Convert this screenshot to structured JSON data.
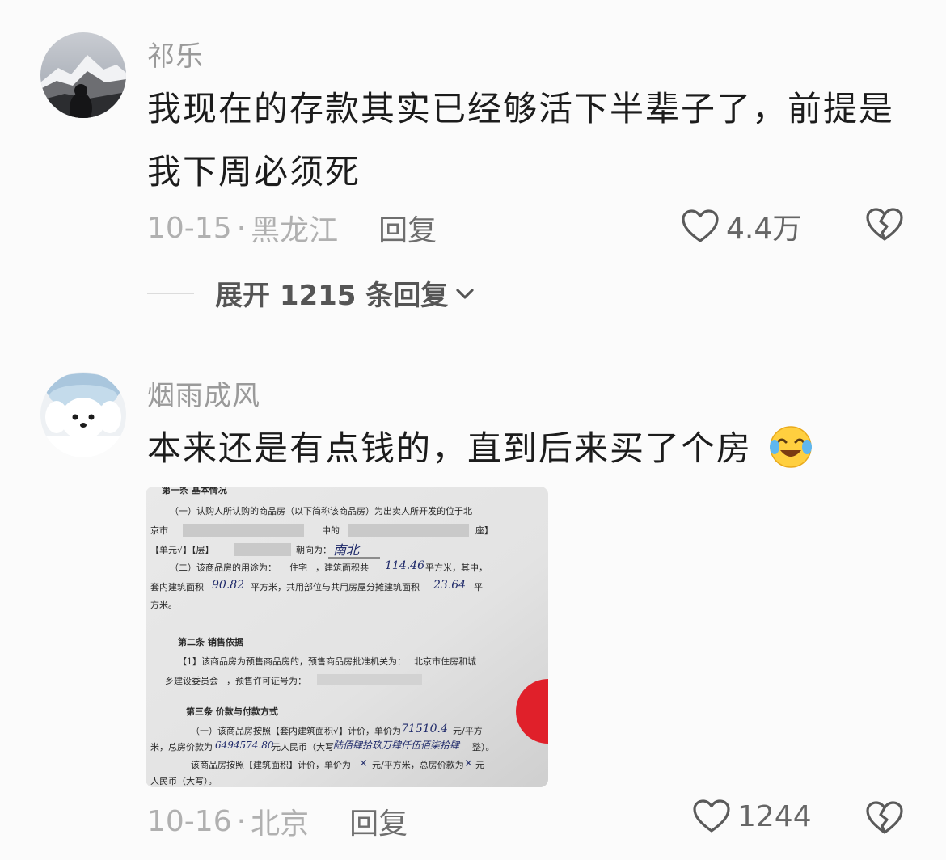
{
  "comments": [
    {
      "username": "祁乐",
      "content": "我现在的存款其实已经够活下半辈子了，前提是我下周必须死",
      "date": "10-15",
      "location": "黑龙江",
      "reply_label": "回复",
      "like_count": "4.4万",
      "expand_label": "展开 1215 条回复",
      "avatar_icon": "snow-mountain-avatar"
    },
    {
      "username": "烟雨成风",
      "content": "本来还是有点钱的，直到后来买了个房",
      "emoji": "crying-laughing-emoji",
      "date": "10-16",
      "location": "北京",
      "reply_label": "回复",
      "like_count": "1244",
      "avatar_icon": "white-dog-avatar",
      "attachment": {
        "lines": [
          "第一条  基本情况",
          "（一）认购人所认购的商品房（以下简称该商品房）为出卖人所开发的位于北",
          "京市",
          "中的",
          "座】",
          "【单元√】【层】",
          "朝向为：",
          "南北",
          "（二）该商品房的用途为：",
          "住宅",
          "，建筑面积共",
          "114.46",
          "平方米，其中，",
          "套内建筑面积",
          "90.82",
          "平方米，共用部位与共用房屋分摊建筑面积",
          "23.64",
          "平",
          "方米。",
          "第二条  销售依据",
          "【1】该商品房为预售商品房的，预售商品房批准机关为：",
          "北京市住房和城",
          "乡建设委员会",
          "，预售许可证号为：",
          "第三条  价款与付款方式",
          "（一）该商品房按照【套内建筑面积√】计价，单价为",
          "71510.4",
          "元/平方",
          "米，总房价款为",
          "6494574.80",
          "元人民币（大写",
          "陆佰肆拾玖万肆仟伍佰柒拾肆",
          "整）。",
          "该商品房按照【建筑面积】计价，单价为",
          "×",
          "元/平方米，总房价款为",
          "×",
          "元",
          "人民币（大写）。"
        ]
      }
    }
  ],
  "colors": {
    "background": "#fbfbfb",
    "username": "#9a9a9a",
    "meta": "#b0b0b0",
    "seal": "#e0202a"
  }
}
